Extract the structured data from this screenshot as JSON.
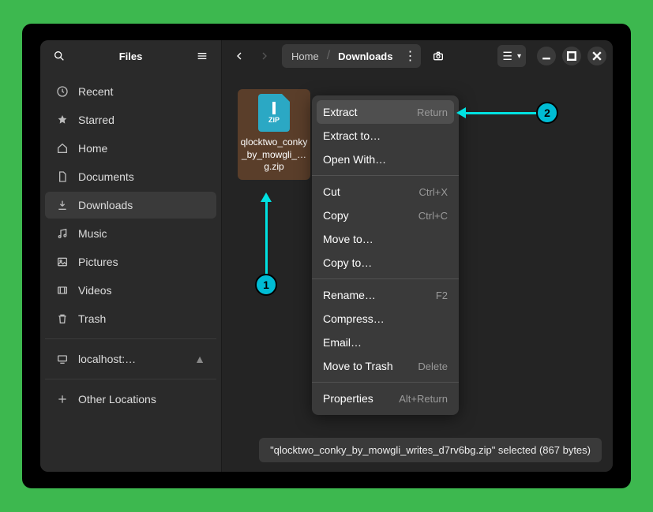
{
  "app_title": "Files",
  "sidebar": {
    "items": [
      {
        "label": "Recent"
      },
      {
        "label": "Starred"
      },
      {
        "label": "Home"
      },
      {
        "label": "Documents"
      },
      {
        "label": "Downloads"
      },
      {
        "label": "Music"
      },
      {
        "label": "Pictures"
      },
      {
        "label": "Videos"
      },
      {
        "label": "Trash"
      }
    ],
    "mount": {
      "label": "localhost:…"
    },
    "other": {
      "label": "Other Locations"
    }
  },
  "path": {
    "seg1": "Home",
    "seg2": "Downloads"
  },
  "file": {
    "icon_label": "ZiP",
    "name": "qlocktwo_conky_by_mowgli_… g.zip"
  },
  "menu": {
    "extract": "Extract",
    "extract_acc": "Return",
    "extract_to": "Extract to…",
    "open_with": "Open With…",
    "cut": "Cut",
    "cut_acc": "Ctrl+X",
    "copy": "Copy",
    "copy_acc": "Ctrl+C",
    "move_to": "Move to…",
    "copy_to": "Copy to…",
    "rename": "Rename…",
    "rename_acc": "F2",
    "compress": "Compress…",
    "email": "Email…",
    "trash": "Move to Trash",
    "trash_acc": "Delete",
    "props": "Properties",
    "props_acc": "Alt+Return"
  },
  "status": "\"qlocktwo_conky_by_mowgli_writes_d7rv6bg.zip\" selected  (867 bytes)",
  "annotations": {
    "b1": "1",
    "b2": "2"
  }
}
